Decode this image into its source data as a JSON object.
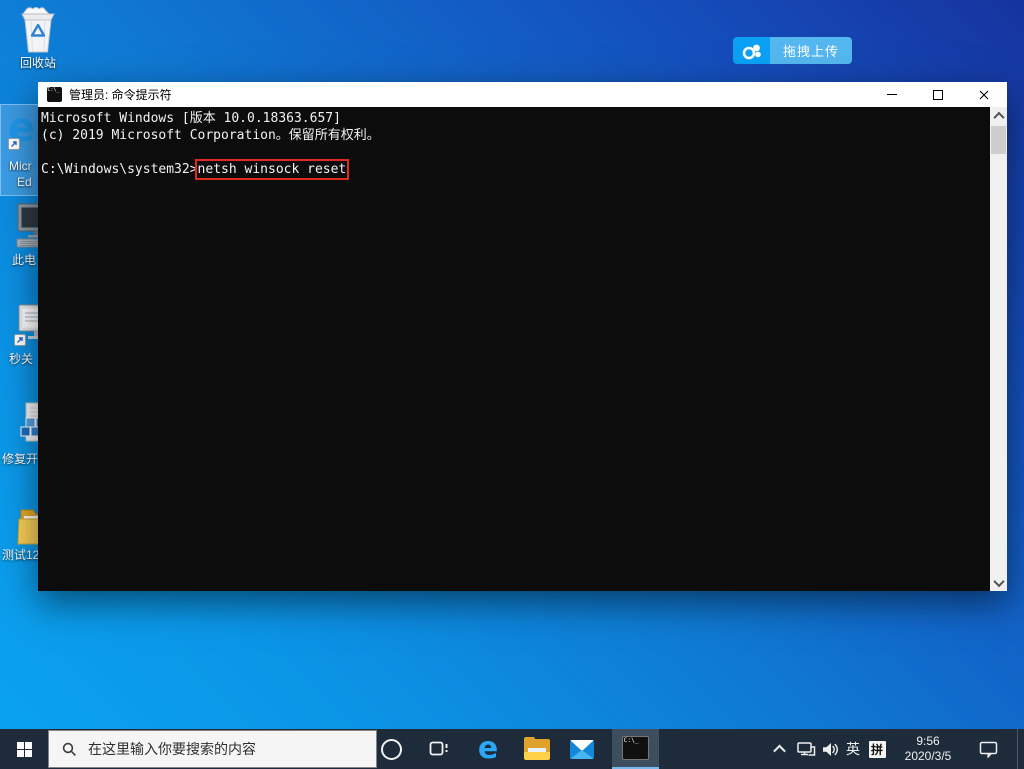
{
  "colors": {
    "command_highlight": "#e02a1e",
    "taskbar_accent": "#76b9ed",
    "upload_blue": "#0aa1f5"
  },
  "glyphs": {
    "edge": "e",
    "cmd_icon_text": "C:\\_"
  },
  "desktop": {
    "upload_button": {
      "label": "拖拽上传"
    },
    "icons": {
      "recycle_bin": {
        "label": "回收站"
      },
      "edge": {
        "label_line1": "Micr",
        "label_line2": "Ed"
      },
      "this_pc": {
        "label": "此电"
      },
      "shortcut_display": {
        "label": "秒关"
      },
      "repair": {
        "label": "修复开"
      },
      "test_folder": {
        "label": "测试12"
      }
    }
  },
  "cmd": {
    "title": "管理员: 命令提示符",
    "line1": "Microsoft Windows [版本 10.0.18363.657]",
    "line2": "(c) 2019 Microsoft Corporation。保留所有权利。",
    "prompt": "C:\\Windows\\system32>",
    "command": "netsh winsock reset"
  },
  "taskbar": {
    "search_placeholder": "在这里输入你要搜索的内容",
    "tray": {
      "language": "英",
      "ime": "拼",
      "time": "9:56",
      "date": "2020/3/5"
    }
  }
}
